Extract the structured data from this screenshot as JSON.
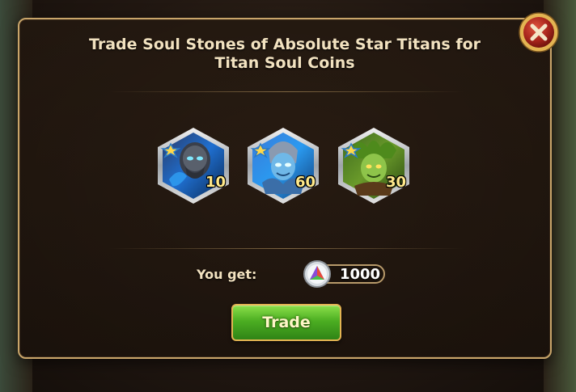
{
  "dialog": {
    "title_line1": "Trade Soul Stones of Absolute Star Titans for",
    "title_line2": "Titan Soul Coins"
  },
  "titans": [
    {
      "name": "titan-1",
      "count": "10",
      "theme": "water-dark"
    },
    {
      "name": "titan-2",
      "count": "60",
      "theme": "water-light"
    },
    {
      "name": "titan-3",
      "count": "30",
      "theme": "earth"
    }
  ],
  "reward": {
    "label": "You get:",
    "amount": "1000",
    "icon": "titan-soul-coin-icon"
  },
  "actions": {
    "trade_label": "Trade",
    "close_icon": "close-icon"
  },
  "colors": {
    "frame_gold": "#c9a56a",
    "button_green": "#4cae22",
    "close_red": "#a8251c",
    "count_yellow": "#ffe98a"
  }
}
